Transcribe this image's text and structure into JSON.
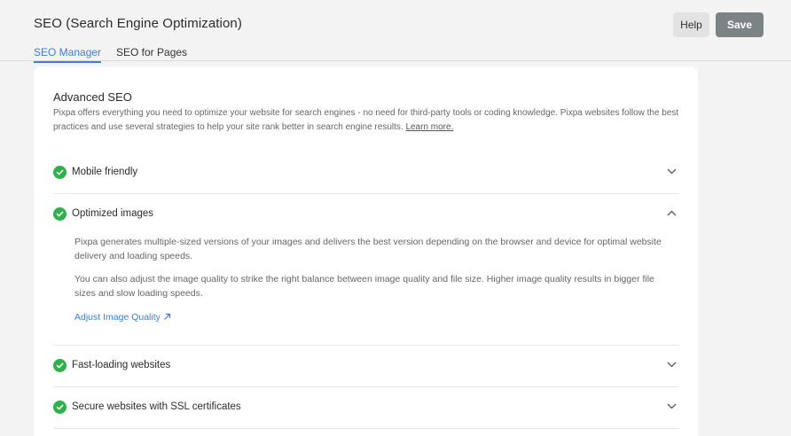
{
  "header": {
    "title": "SEO (Search Engine Optimization)",
    "help_label": "Help",
    "save_label": "Save"
  },
  "tabs": [
    {
      "label": "SEO Manager",
      "active": true
    },
    {
      "label": "SEO for Pages",
      "active": false
    }
  ],
  "advanced_seo": {
    "title": "Advanced SEO",
    "description": "Pixpa offers everything you need to optimize your website for search engines - no need for third-party tools or coding knowledge. Pixpa websites follow the best practices and use several strategies to help your site rank better in search engine results.",
    "learn_more": "Learn more.",
    "items": [
      {
        "label": "Mobile friendly",
        "expanded": false,
        "icon": "check-circle-icon"
      },
      {
        "label": "Optimized images",
        "expanded": true,
        "icon": "check-circle-icon",
        "paragraphs": [
          "Pixpa generates multiple-sized versions of your images and delivers the best version depending on the browser and device for optimal website delivery and loading speeds.",
          "You can also adjust the image quality to strike the right balance between image quality and file size. Higher image quality results in bigger file sizes and slow loading speeds."
        ],
        "link": "Adjust Image Quality"
      },
      {
        "label": "Fast-loading websites",
        "expanded": false,
        "icon": "check-circle-icon"
      },
      {
        "label": "Secure websites with SSL certificates",
        "expanded": false,
        "icon": "check-circle-icon"
      }
    ]
  },
  "colors": {
    "accent": "#3b7fd6",
    "check": "#2eb04a",
    "save_button": "#7d8285",
    "background": "#f3f3f3"
  }
}
